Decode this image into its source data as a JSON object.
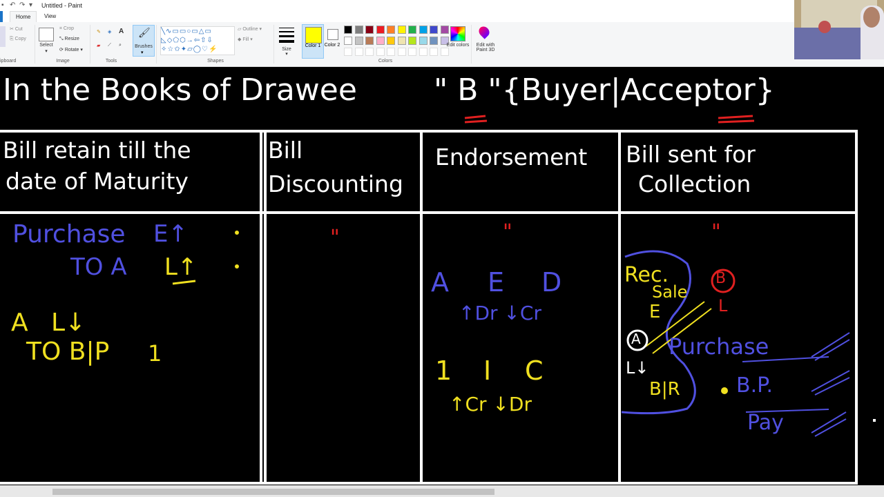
{
  "window": {
    "title": "Untitled - Paint"
  },
  "tabs": [
    "Home",
    "View"
  ],
  "ribbon": {
    "clipboard": {
      "label": "ipboard",
      "cut": "Cut",
      "copy": "Copy"
    },
    "image": {
      "label": "Image",
      "select": "Select",
      "crop": "Crop",
      "resize": "Resize",
      "rotate": "Rotate"
    },
    "tools": {
      "label": "Tools"
    },
    "brushes": {
      "label": "Brushes"
    },
    "shapes": {
      "label": "Shapes",
      "outline": "Outline",
      "fill": "Fill"
    },
    "size": {
      "label": "Size"
    },
    "color1": {
      "label": "Color 1",
      "value": "#ffff00"
    },
    "color2": {
      "label": "Color 2",
      "value": "#ffffff"
    },
    "colors": {
      "label": "Colors",
      "palette_row1": [
        "#000000",
        "#7f7f7f",
        "#880015",
        "#ed1c24",
        "#ff7f27",
        "#fff200",
        "#22b14c",
        "#00a2e8",
        "#3f48cc",
        "#a349a4"
      ],
      "palette_row2": [
        "#ffffff",
        "#c3c3c3",
        "#b97a57",
        "#ffaec9",
        "#ffc90e",
        "#efe4b0",
        "#b5e61d",
        "#99d9ea",
        "#7092be",
        "#c8bfe7"
      ]
    },
    "edit_colors": "Edit colors",
    "edit_paint3d": "Edit with Paint 3D"
  },
  "board": {
    "heading": "In the Books of Drawee",
    "heading_party": "\" B \"{Buyer|Acceptor}",
    "columns": [
      {
        "header_line1": "Bill retain till the",
        "header_line2": "date of Maturity",
        "entry1_debit": "Purchase",
        "entry1_debit_mark": "E↑",
        "entry1_credit": "TO A",
        "entry1_credit_mark": "L↑",
        "entry2_debit": "A",
        "entry2_debit_mark": "L↓",
        "entry2_credit": "TO B|P",
        "entry2_credit_mark": "1"
      },
      {
        "header_line1": "Bill",
        "header_line2": "Discounting",
        "ditto": "\""
      },
      {
        "header_line1": "Endorsement",
        "ditto": "\"",
        "row1": [
          "A",
          "E",
          "D"
        ],
        "row1_note": "↑Dr ↓Cr",
        "row2": [
          "1",
          "I",
          "C"
        ],
        "row2_note": "↑Cr ↓Dr"
      },
      {
        "header_line1": "Bill sent for",
        "header_line2": "Collection",
        "ditto": "\"",
        "rec": "Rec.",
        "sale": "Sale",
        "e_mark": "E",
        "b_circle": "B",
        "a_circle": "A",
        "l_mark": "L↓",
        "b_l": "L",
        "bir": "B|R",
        "purchase": "Purchase",
        "bp": "B.P.",
        "pay": "Pay"
      }
    ]
  }
}
